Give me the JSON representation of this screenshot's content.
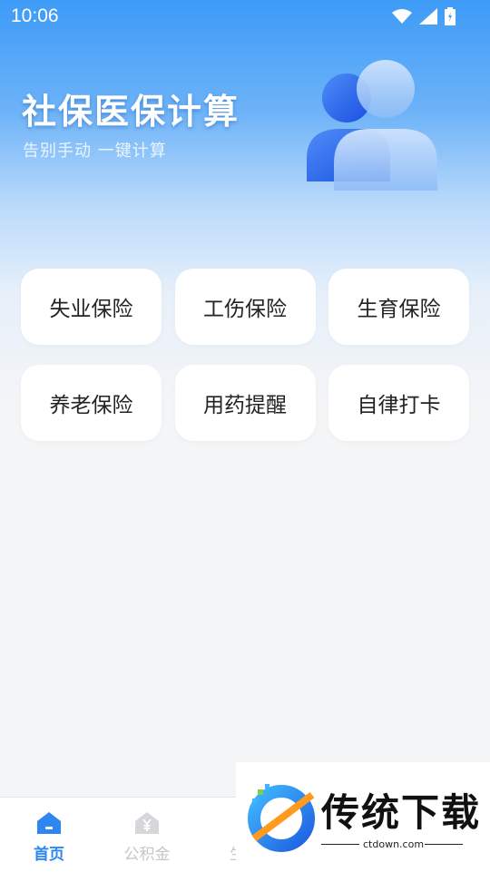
{
  "status_bar": {
    "time": "10:06"
  },
  "hero": {
    "title": "社保医保计算",
    "subtitle": "告别手动 一键计算",
    "illustration": "users-icon"
  },
  "grid": {
    "items": [
      {
        "label": "失业保险"
      },
      {
        "label": "工伤保险"
      },
      {
        "label": "生育保险"
      },
      {
        "label": "养老保险"
      },
      {
        "label": "用药提醒"
      },
      {
        "label": "自律打卡"
      }
    ]
  },
  "tabbar": {
    "tabs": [
      {
        "label": "首页",
        "icon": "home-icon",
        "active": true
      },
      {
        "label": "公积金",
        "icon": "fund-house-icon",
        "active": false
      },
      {
        "label": "生活",
        "icon": "life-icon",
        "active": false
      }
    ]
  },
  "watermark": {
    "brand": "传统下载",
    "url": "ctdown.com"
  },
  "colors": {
    "accent": "#2e87f0",
    "header_blue": "#3d9bf7",
    "card_bg": "#ffffff"
  }
}
